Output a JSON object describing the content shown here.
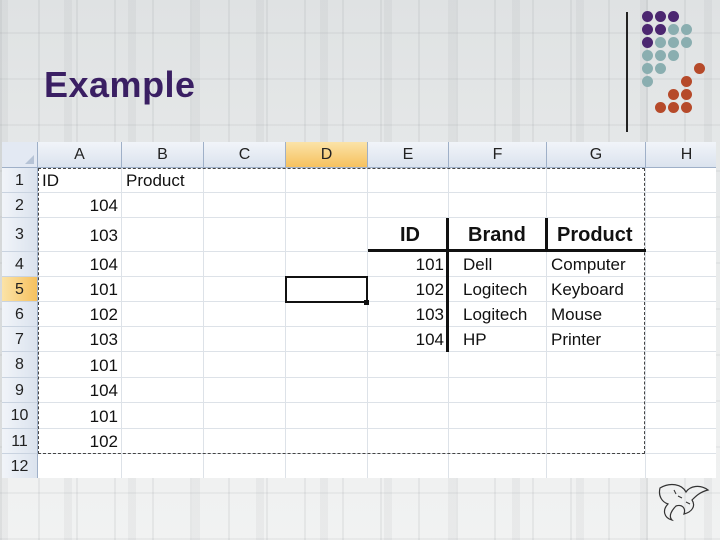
{
  "slide": {
    "title": "Example"
  },
  "sheet": {
    "columns": [
      "A",
      "B",
      "C",
      "D",
      "E",
      "F",
      "G",
      "H"
    ],
    "rows": [
      "1",
      "2",
      "3",
      "4",
      "5",
      "6",
      "7",
      "8",
      "9",
      "10",
      "11",
      "12"
    ],
    "selected_column": "D",
    "selected_row": "5",
    "list": {
      "header_id": "ID",
      "header_product": "Product",
      "ids": [
        "104",
        "103",
        "104",
        "101",
        "102",
        "103",
        "101",
        "104",
        "101",
        "102"
      ]
    },
    "lookup": {
      "headers": [
        "ID",
        "Brand",
        "Product"
      ],
      "rows": [
        [
          "101",
          "Dell",
          "Computer"
        ],
        [
          "102",
          "Logitech",
          "Keyboard"
        ],
        [
          "103",
          "Logitech",
          "Mouse"
        ],
        [
          "104",
          "HP",
          "Printer"
        ]
      ]
    }
  },
  "colors": {
    "title": "#3a1f63",
    "dot_purple": "#4b2670",
    "dot_teal": "#8aaeb0",
    "dot_orange": "#b64a2a",
    "selection_header": "#f6c15e"
  }
}
